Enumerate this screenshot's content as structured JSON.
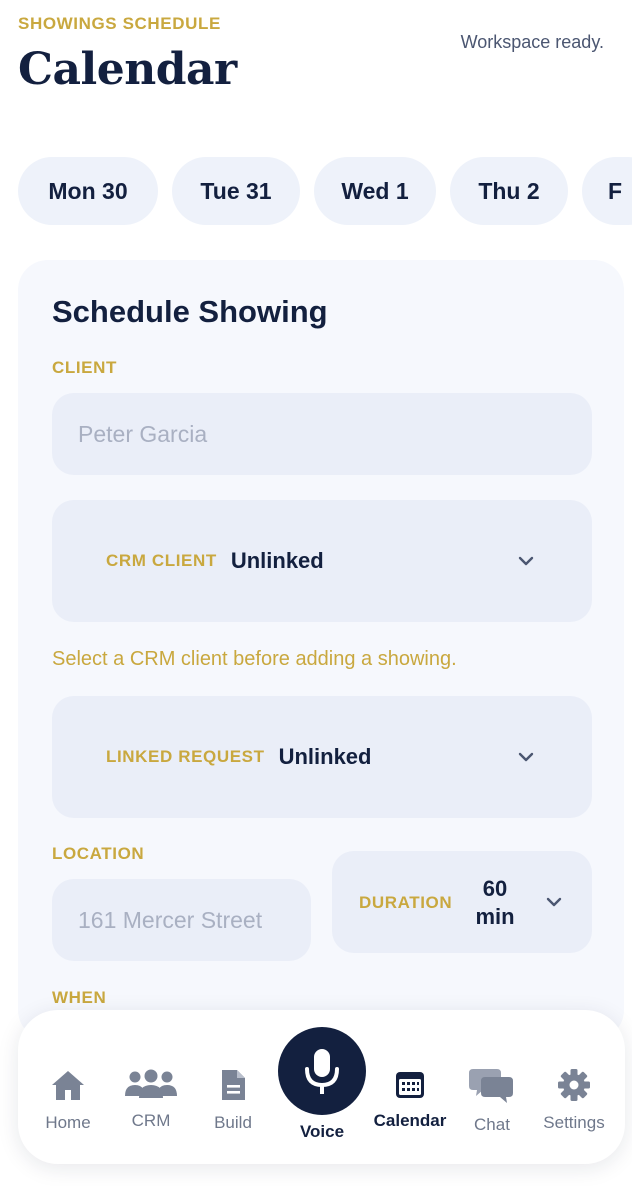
{
  "header": {
    "eyebrow": "SHOWINGS SCHEDULE",
    "title": "Calendar",
    "status": "Workspace ready."
  },
  "days": [
    "Mon 30",
    "Tue 31",
    "Wed 1",
    "Thu 2",
    "F"
  ],
  "form": {
    "title": "Schedule Showing",
    "client_label": "CLIENT",
    "client_placeholder": "Peter Garcia",
    "crm_client_label": "CRM CLIENT",
    "crm_client_value": "Unlinked",
    "crm_hint": "Select a CRM client before adding a showing.",
    "linked_request_label": "LINKED REQUEST",
    "linked_request_value": "Unlinked",
    "location_label": "LOCATION",
    "location_placeholder": "161 Mercer Street",
    "duration_label": "DURATION",
    "duration_value_num": "60",
    "duration_value_unit": "min",
    "when_label": "WHEN"
  },
  "tabs": [
    {
      "label": "Home",
      "icon": "home-icon"
    },
    {
      "label": "CRM",
      "icon": "people-icon"
    },
    {
      "label": "Build",
      "icon": "document-icon"
    },
    {
      "label": "Voice",
      "icon": "microphone-icon"
    },
    {
      "label": "Calendar",
      "icon": "calendar-icon"
    },
    {
      "label": "Chat",
      "icon": "chat-bubbles-icon"
    },
    {
      "label": "Settings",
      "icon": "gear-icon"
    }
  ],
  "colors": {
    "navy": "#13203f",
    "gold": "#c9a83f",
    "muted": "#6f788b",
    "field_bg": "#eaeef8"
  }
}
